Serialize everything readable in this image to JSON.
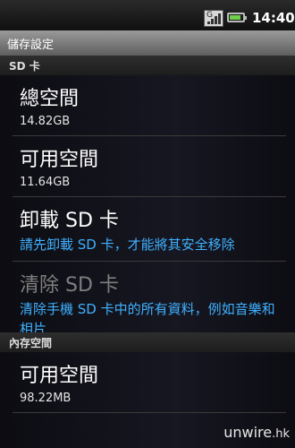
{
  "status": {
    "network": "G",
    "time": "14:40"
  },
  "title": "儲存設定",
  "sections": {
    "sd": "SD 卡",
    "internal": "內存空間"
  },
  "sd_total": {
    "label": "總空間",
    "value": "14.82GB"
  },
  "sd_available": {
    "label": "可用空間",
    "value": "11.64GB"
  },
  "unmount": {
    "label": "卸載 SD 卡",
    "summary": "請先卸載 SD 卡，才能將其安全移除"
  },
  "erase": {
    "label": "清除 SD 卡",
    "summary": "清除手機 SD 卡中的所有資料，例如音樂和相片"
  },
  "internal_available": {
    "label": "可用空間",
    "value": "98.22MB"
  },
  "watermark": {
    "main": "unwire",
    "tld": ".hk"
  },
  "colors": {
    "link_blue": "#3fb1ff",
    "battery": "#6fd14a"
  }
}
